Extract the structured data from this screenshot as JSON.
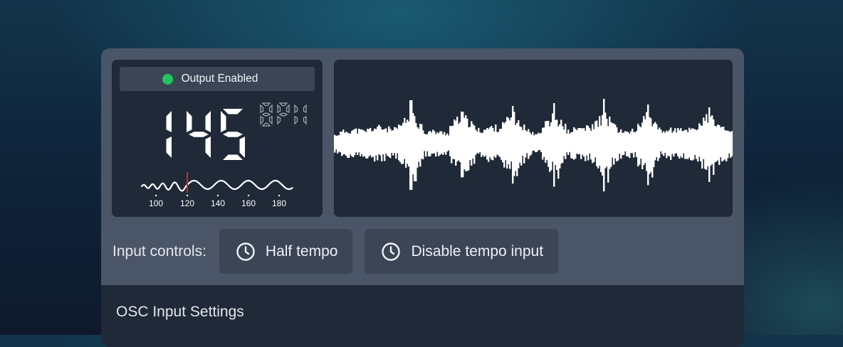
{
  "status": {
    "label": "Output Enabled",
    "indicator_color": "#22c55e"
  },
  "tempo": {
    "value": "145",
    "unit": "BPM",
    "scale_ticks": [
      "100",
      "120",
      "140",
      "160",
      "180"
    ],
    "marker_color": "#dc2626"
  },
  "waveform": {
    "color": "#ffffff"
  },
  "controls": {
    "label": "Input controls:",
    "half_tempo_label": "Half tempo",
    "disable_tempo_label": "Disable tempo input",
    "button_icon": "clock-icon"
  },
  "osc": {
    "title": "OSC Input Settings"
  }
}
